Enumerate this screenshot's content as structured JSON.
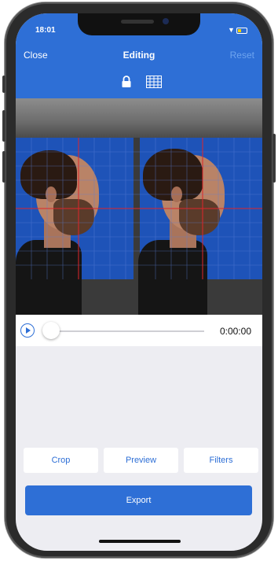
{
  "status_bar": {
    "time": "18:01"
  },
  "nav": {
    "close_label": "Close",
    "title": "Editing",
    "reset_label": "Reset"
  },
  "toolbar_icons": {
    "lock": "lock-icon",
    "grid": "grid-icon"
  },
  "playback": {
    "time": "0:00:00",
    "progress": 0
  },
  "actions": {
    "crop_label": "Crop",
    "preview_label": "Preview",
    "filters_label": "Filters"
  },
  "export": {
    "label": "Export"
  },
  "colors": {
    "accent": "#2e6fd6",
    "reset_disabled": "#6ea4ef",
    "background": "#ededf2"
  }
}
